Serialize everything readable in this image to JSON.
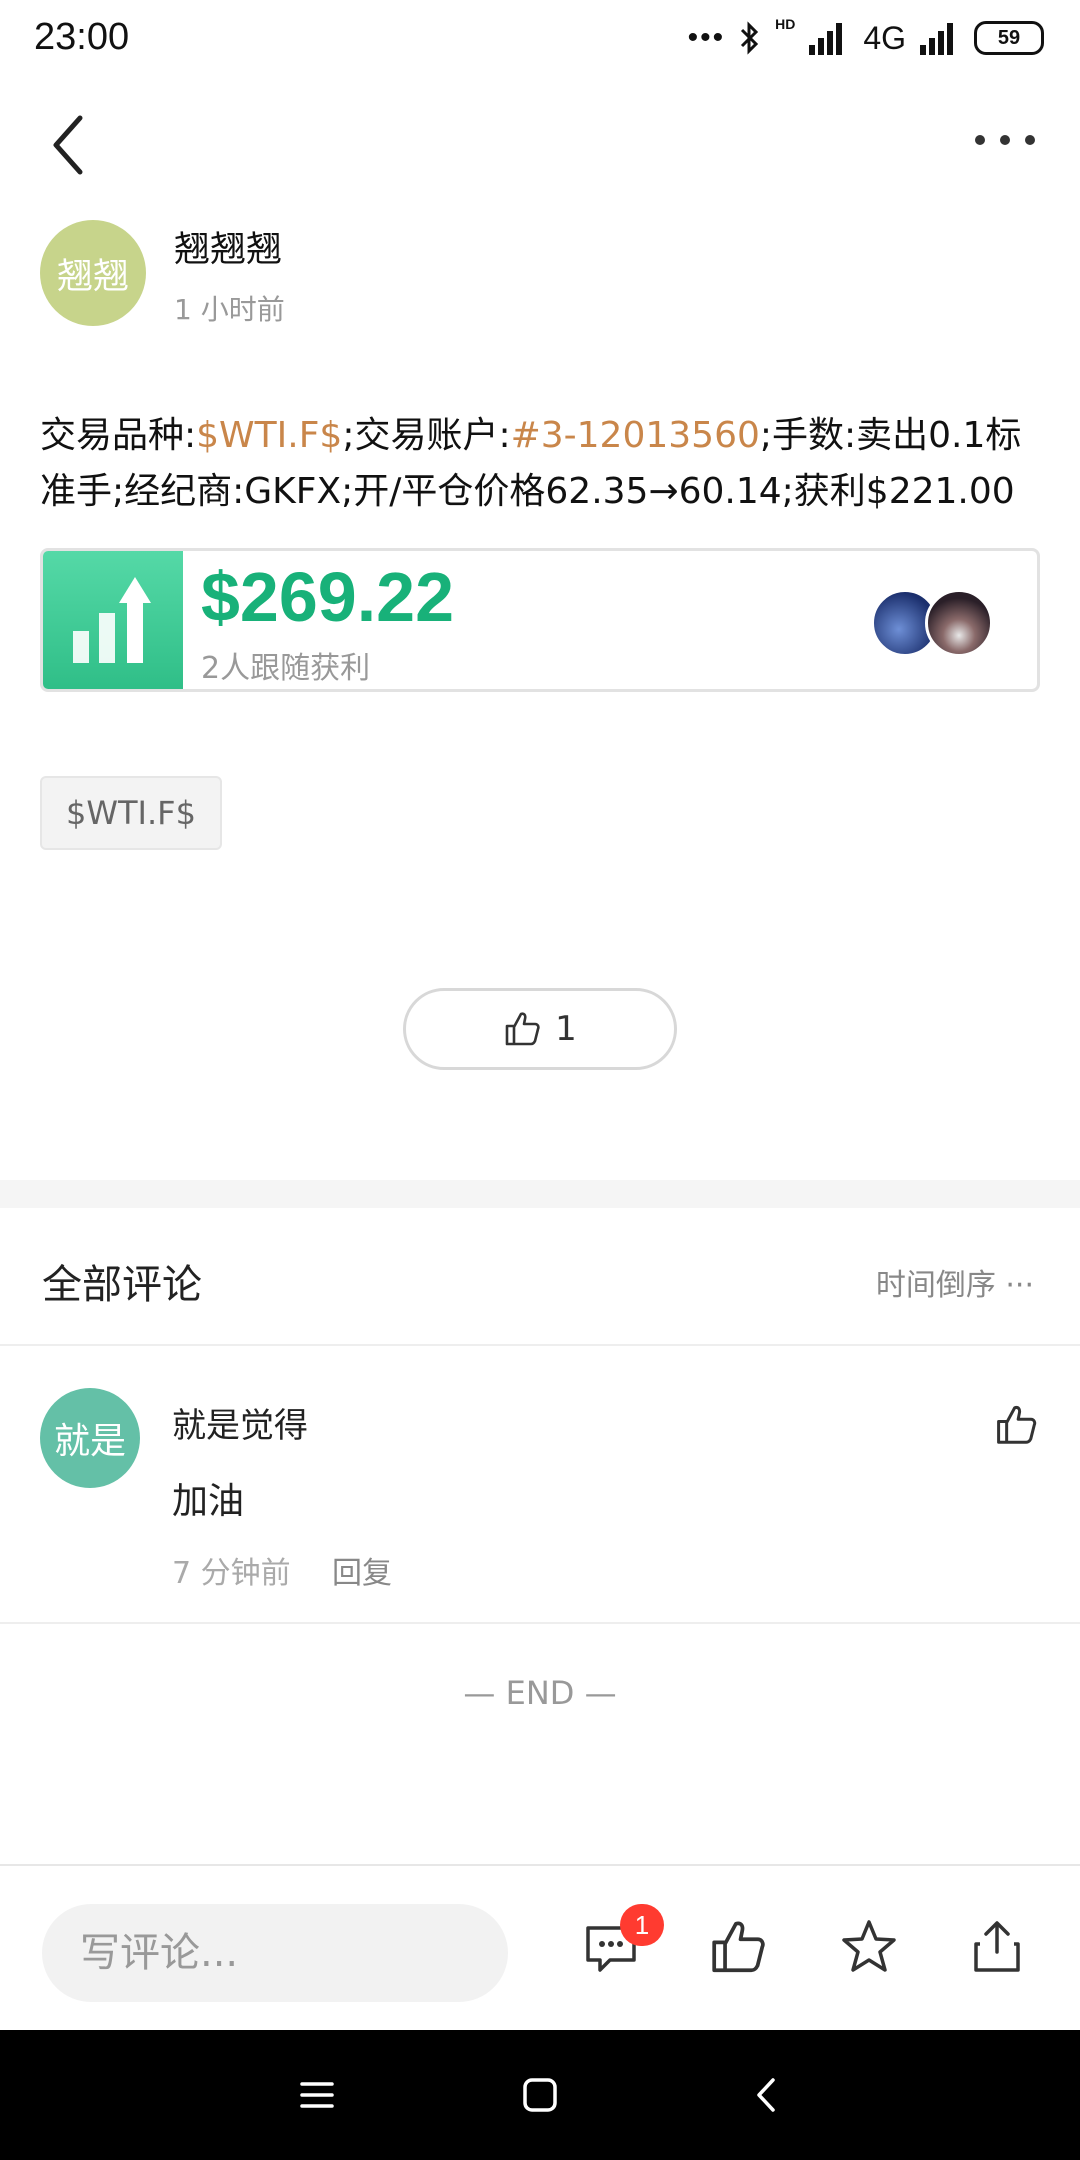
{
  "status_bar": {
    "time": "23:00",
    "network": "4G",
    "hd": "HD",
    "battery": "59"
  },
  "author": {
    "avatar_text": "翘翘",
    "name": "翘翘翘",
    "time": "1 小时前"
  },
  "post": {
    "segments": [
      {
        "text": "交易品种:",
        "highlight": false
      },
      {
        "text": "$WTI.F$",
        "highlight": true
      },
      {
        "text": ";交易账户:",
        "highlight": false
      },
      {
        "text": "#3-12013560",
        "highlight": true
      },
      {
        "text": ";手数:卖出0.1标准手;经纪商:GKFX;开/平仓价格62.35→60.14;获利$221.00",
        "highlight": false
      }
    ]
  },
  "profit_card": {
    "amount": "$269.22",
    "followers_text": "2人跟随获利",
    "accent_color": "#18b179"
  },
  "tag": "$WTI.F$",
  "like_button": {
    "count": "1"
  },
  "comments_section": {
    "title": "全部评论",
    "sort_label": "时间倒序",
    "items": [
      {
        "avatar_text": "就是",
        "name": "就是觉得",
        "text": "加油",
        "time": "7 分钟前",
        "reply_label": "回复"
      }
    ]
  },
  "end_marker": "— END —",
  "bottom_bar": {
    "comment_placeholder": "写评论...",
    "comment_badge": "1",
    "icons": [
      "comments-icon",
      "thumbs-up-icon",
      "star-icon",
      "share-icon"
    ]
  },
  "colors": {
    "highlight": "#c9864a",
    "profit_green": "#18b179",
    "badge_red": "#ff3b30"
  }
}
